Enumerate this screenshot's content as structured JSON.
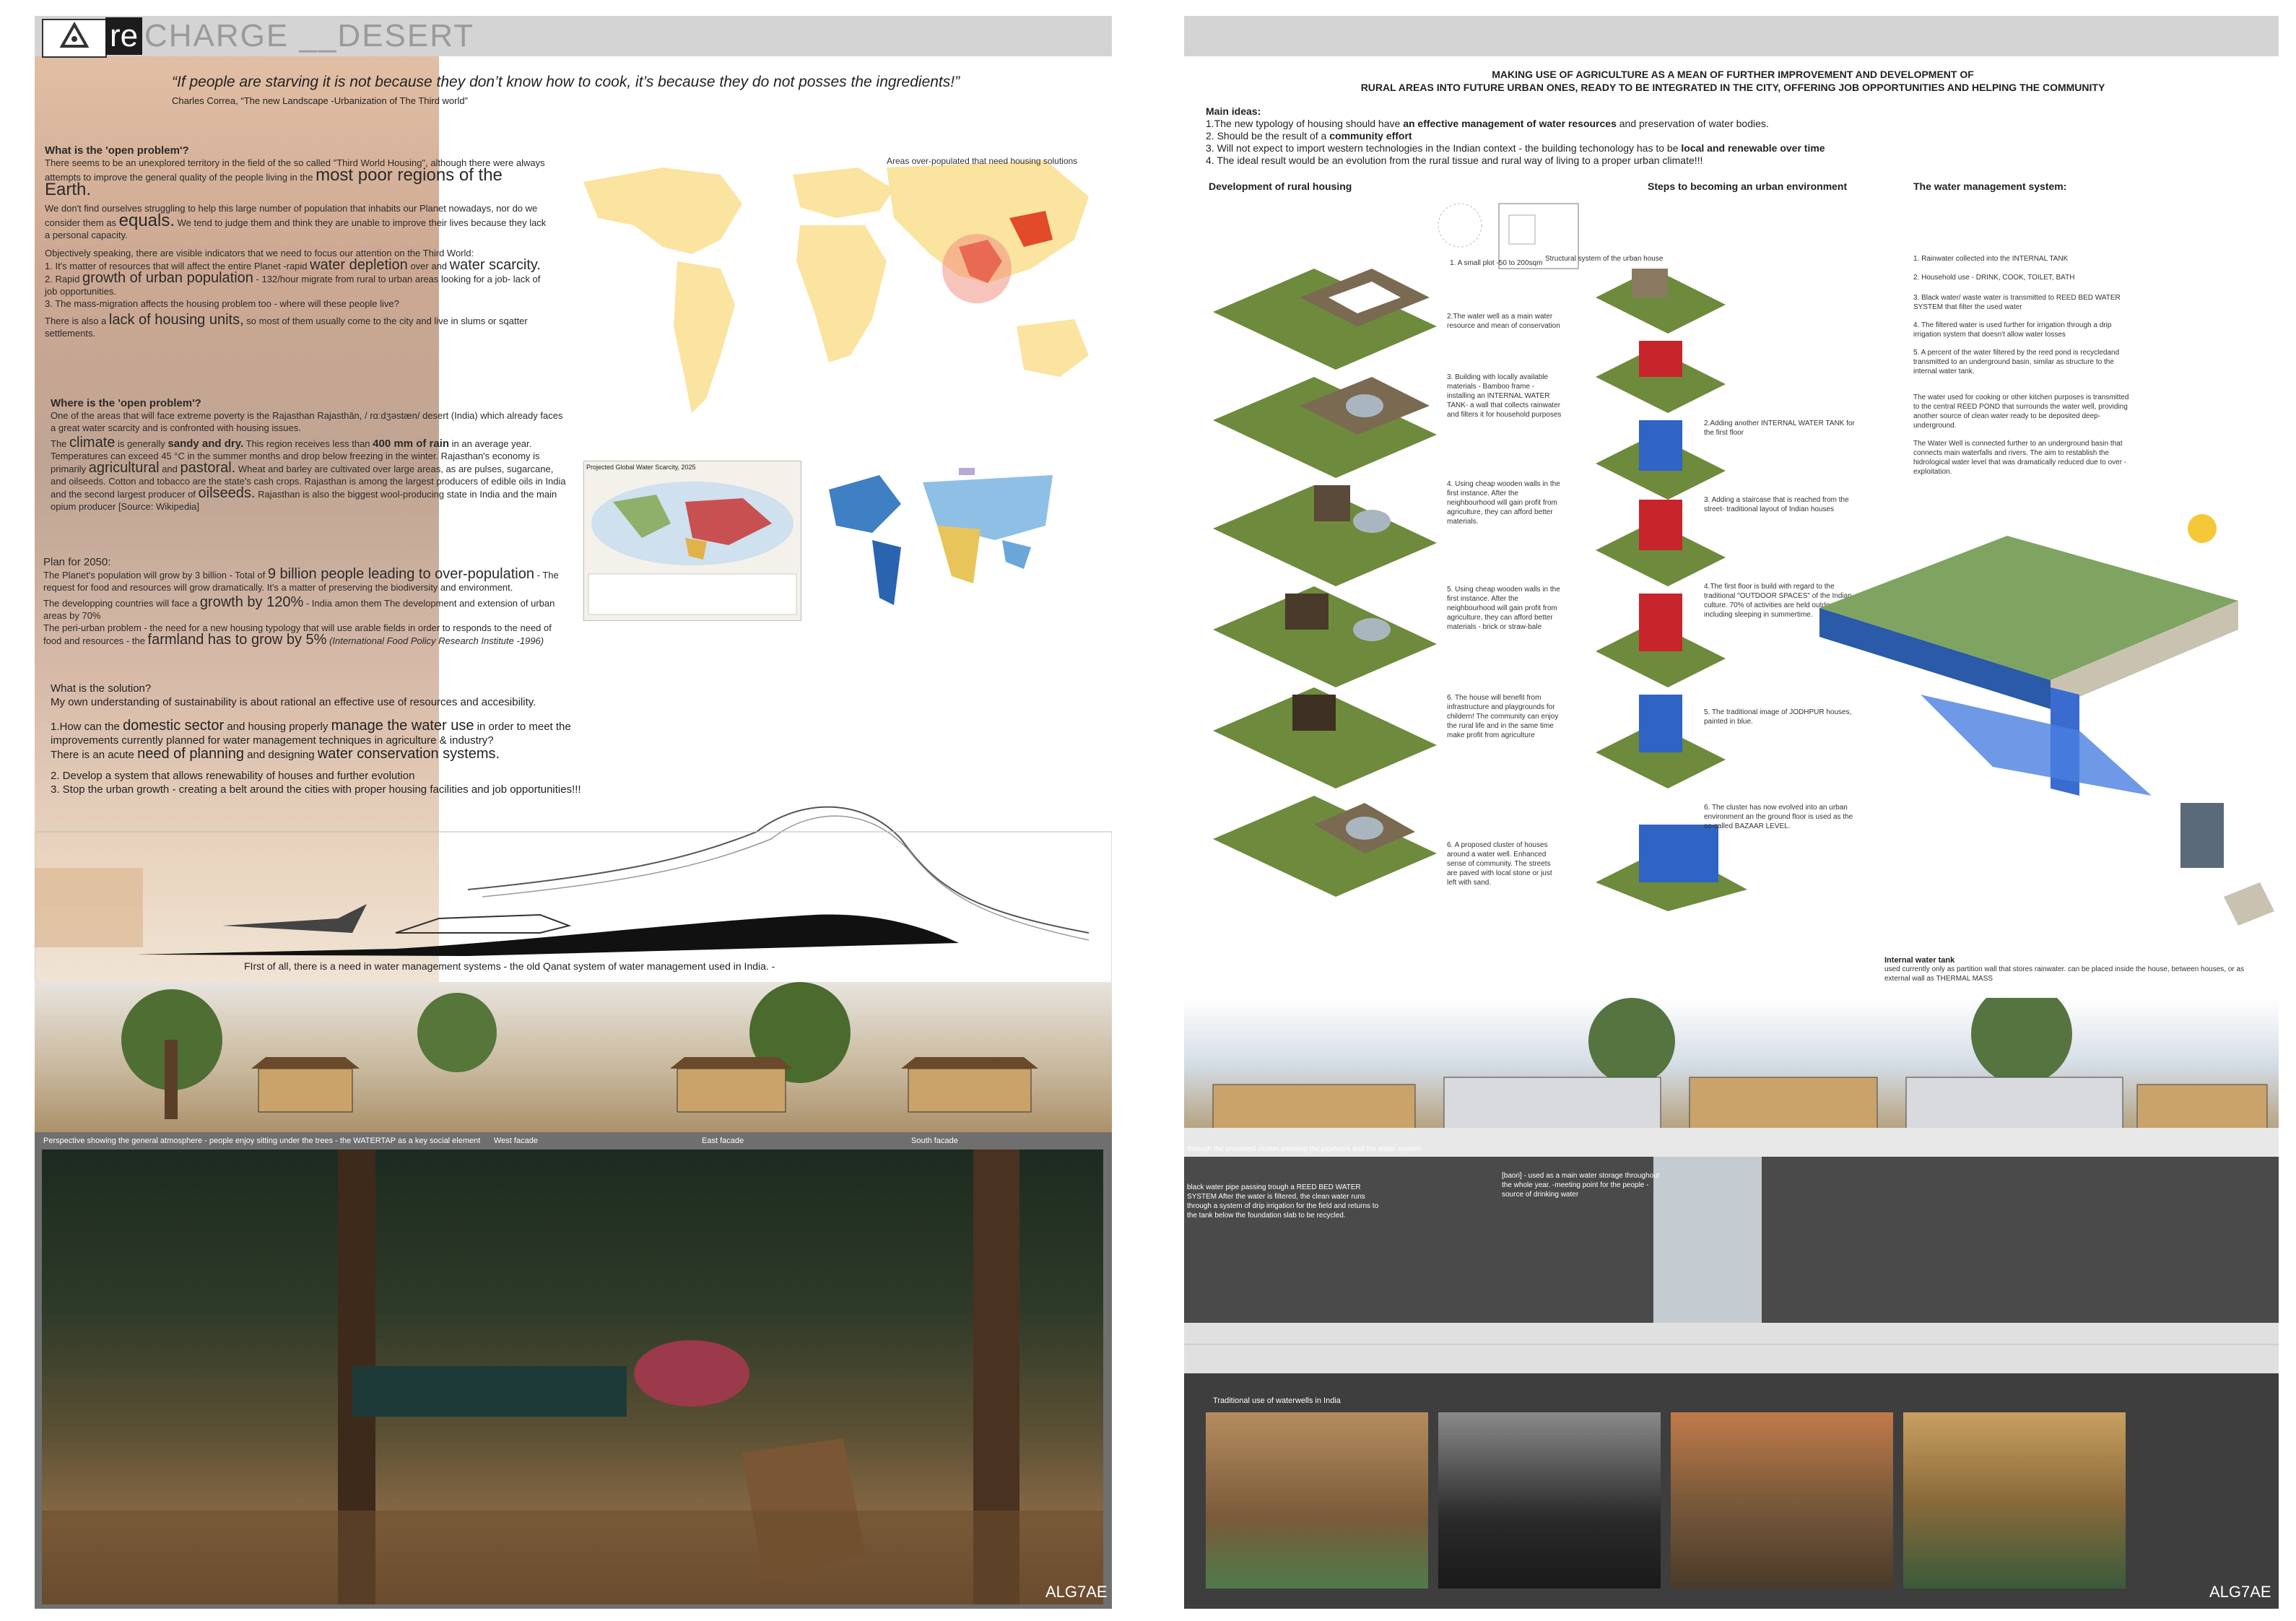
{
  "left": {
    "title_re": "re",
    "title_rest": "CHARGE __DESERT",
    "quote": "“If people are starving it is not because they don’t know how to cook, it’s because they do not posses the ingredients!”",
    "quote_source": "Charles Correa, “The new Landscape -Urbanization of The Third world”",
    "open_problem_heading": "What is the 'open problem'?",
    "op_p1a": "There seems to be an unexplored territory in the field of the so called \"Third World Housing\", although there were always attempts to improve the general quality of the people living in the",
    "op_p1b": "most poor regions of the Earth.",
    "op_p2a": "We don't find ourselves struggling to help this large number of population that inhabits our Planet nowadays, nor do we consider them as",
    "op_p2b": "equals.",
    "op_p2c": "We tend to judge them and think they are unable to improve their lives because they lack a personal capacity.",
    "op_p3": "Objectively speaking, there are visible indicators that we need to focus our attention on the Third World:",
    "op_l1a": "1. It's matter of resources that will affect the entire Planet -rapid",
    "op_l1b": "water depletion",
    "op_l1c": "over and",
    "op_l1d": "water scarcity.",
    "op_l2a": "2. Rapid",
    "op_l2b": "growth of urban population",
    "op_l2c": "- 132/hour migrate from rural to urban areas looking for a job- lack of job opportunities.",
    "op_l3": "3. The mass-migration affects the housing problem too - where will these people live?",
    "op_l4a": "There is also a",
    "op_l4b": "lack of housing units,",
    "op_l4c": "so most of them usually come to the city and live in slums or sqatter settlements.",
    "map_caption": "Areas over-populated that need housing solutions",
    "where_heading": "Where is the 'open problem'?",
    "wh_p1": "One of the areas that will face extreme poverty is the Rajasthan Rajasthān, / rɑːdʒəstæn/ desert (India) which already faces a great water scarcity and is confronted with housing issues.",
    "wh_p2a": "The",
    "wh_p2b": "climate",
    "wh_p2c": "is generally",
    "wh_p2d": "sandy and dry.",
    "wh_p2e": "This region receives less than",
    "wh_p2f": "400 mm of rain",
    "wh_p2g": "in an average year. Temperatures can exceed 45 °C in the summer months and drop below freezing in the winter. Rajasthan's economy is primarily",
    "wh_p2h": "agricultural",
    "wh_p2i": "and",
    "wh_p2j": "pastoral.",
    "wh_p2k": "Wheat and barley are cultivated over large areas, as are pulses, sugarcane, and oilseeds. Cotton and tobacco are the state's cash crops. Rajasthan is among the largest producers of edible oils in India and the second largest producer of",
    "wh_p2l": "oilseeds.",
    "wh_p2m": "Rajasthan is also the biggest wool-producing state in India and the main opium producer [Source: Wikipedia]",
    "water_map_1_title": "Projected Global Water Scarcity, 2025",
    "plan_heading": "Plan for 2050:",
    "pl_p1a": "The Planet's population will grow by 3 billion - Total of",
    "pl_p1b": "9 billion people leading to over-population",
    "pl_p1c": "- The request for food and resources will grow dramatically. It's a matter of preserving the biodiversity and environment.",
    "pl_p2a": "The developping countries will face a",
    "pl_p2b": "growth by 120%",
    "pl_p2c": "- India amon them The development and extension of urban areas by 70%",
    "pl_p3a": "The peri-urban problem - the need for a new housing typology that will use arable fields in order to responds to the need of food and resources - the",
    "pl_p3b": "farmland has to grow by 5%",
    "pl_p3c": "(International Food Policy Research Institute -1996)",
    "solution_heading": "What is the solution?",
    "so_p1": "My own understanding of sustainability is about rational an effective use of resources and accesibility.",
    "so_p2a": "1.How can the",
    "so_p2b": "domestic sector",
    "so_p2c": "and housing properly",
    "so_p2d": "manage the water use",
    "so_p2e": "in order to meet the improvements currently planned for water management techniques in agriculture & industry?",
    "so_p3a": "There is an acute",
    "so_p3b": "need of planning",
    "so_p3c": "and designing",
    "so_p3d": "water conservation systems.",
    "so_p4": "2. Develop a system that allows renewability of houses and further evolution",
    "so_p5": "3. Stop the urban growth - creating a belt around the cities with proper housing facilities and job opportunities!!!",
    "section_caption": "FIrst of all, there is a need in water management systems - the old Qanat system of water management used in India. -",
    "render_caption": "Perspective showing the general atmosphere - people enjoy sitting under the trees - the WATERTAP as a key social element",
    "facade_west": "West facade",
    "facade_east": "East facade",
    "facade_south": "South facade",
    "code": "ALG7AE"
  },
  "right": {
    "heading_1": "MAKING USE OF AGRICULTURE AS A MEAN OF FURTHER IMPROVEMENT AND DEVELOPMENT OF",
    "heading_2": "RURAL AREAS INTO FUTURE URBAN ONES, READY TO BE INTEGRATED IN THE CITY,  OFFERING JOB OPPORTUNITIES AND HELPING THE COMMUNITY",
    "main_ideas": "Main ideas:",
    "idea_1a": "1.The new typology of housing should have",
    "idea_1b": "an effective management of water resources",
    "idea_1c": "and preservation of water bodies.",
    "idea_2a": "2. Should  be the result of a",
    "idea_2b": "community effort",
    "idea_3a": "3. Will not expect to import western technologies in the Indian context - the building techonology has to be",
    "idea_3b": "local and renewable over time",
    "idea_4": "4. The ideal result would be an evolution from the rural tissue and rural way of living to a proper urban climate!!!",
    "col_1": "Development of  rural housing",
    "col_2": "Steps to becoming an urban environment",
    "col_3": "The water management system:",
    "plot_caption": "1. A small plot -50 to 200sqm",
    "struct_caption": "Structural system of the urban house",
    "dev_steps": [
      "2.The water well as a main water resource and mean of conservation",
      "3. Building with locally available materials - Bamboo frame - installing an INTERNAL WATER TANK- a wall that collects rainwater and filters it for household purposes",
      "4. Using cheap wooden walls in the first instance. After the neighbourhood will gain profit from agriculture, they can afford better materials.",
      "5. Using cheap wooden walls in the first instance. After the neighbourhood will gain profit from agriculture, they can afford better materials - brick or straw-bale",
      "6. The house will benefit from infrastructure and playgrounds for childern! The community can enjoy the rural life and in the same time make profit from agriculture",
      "6. A proposed cluster of houses around a water well. Enhanced sense of community. The streets are paved with local stone or just left with sand."
    ],
    "urban_steps": [
      "2.Adding another INTERNAL WATER TANK for the first floor",
      "3. Adding a staircase that is reached from the street- traditional layout of Indian houses",
      "4.The first floor is build with regard to the traditional \"OUTDOOR SPACES\" of the Indian culture. 70% of activities are held outdoor, including sleeping in summertime.",
      "5. The traditional image of JODHPUR houses, painted in blue.",
      "6. The cluster has now evolved into an urban environment an the ground floor is used as the so-called BAZAAR LEVEL."
    ],
    "water_steps": [
      "1. Rainwater collected into the INTERNAL TANK",
      "2. Household use - DRINK, COOK, TOILET, BATH",
      "3. Black water/ waste water is transmitted to REED BED WATER SYSTEM that filter the used water",
      "4. The filtered water is used further for irrigation through a drip irrigation system that doesn't allow water losses",
      "5. A percent of the water filtered by the  reed pond is recycledand transmitted to an underground basin, similar as structure to the internal water tank.",
      "The water used for cooking or other kitchen purposes is transmitted to the central REED POND that surrounds the water well, providing another source of clean water ready to be deposited deep-underground.",
      "The Water Well is connected further to an underground basin that connects main waterfalls and rivers. The aim to restablish the hidrological water level that was dramatically reduced due to over - exploitation."
    ],
    "tank_title": "Internal water tank",
    "tank_text": "used currently only as partition wall that stores rainwater. can be placed inside the house, between houses, or as external wall as THERMAL MASS",
    "section_l1": "through the proposed cluster showing the pipework and the water system",
    "section_l2": "black water pipe passing trough a REED BED WATER SYSTEM After the water is filtered, the clean water runs through a system of drip irrigation for the field and returns to the tank below the foundation slab to be recycled.",
    "section_l3": "[baori] - used as a main water storage throughout the whole year. -meeting point for the people -source of drinking water",
    "photos_title": "Traditional use of waterwells in India",
    "code": "ALG7AE"
  },
  "colors": {
    "title_bar": "#d4d4d4",
    "dark_strip": "#4a4a4a",
    "map_yellow": "#fbe3a0",
    "map_red": "#d9282a",
    "blue_house": "#2f63c4",
    "red_house": "#c8242b"
  }
}
